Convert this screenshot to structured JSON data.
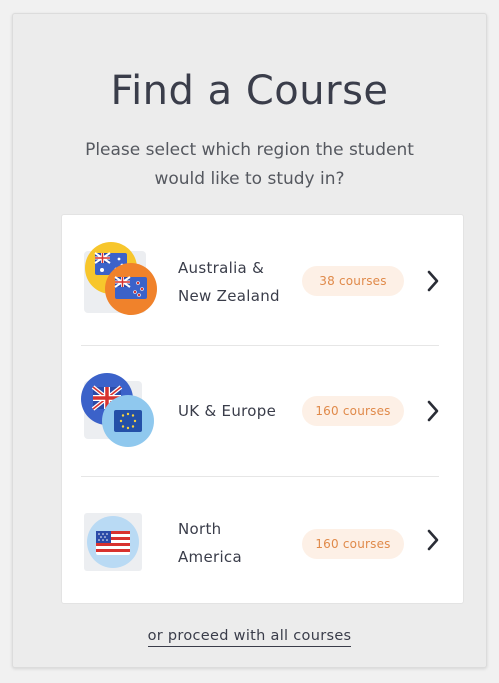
{
  "title": "Find a Course",
  "subtitle": "Please select which region the student would like to study in?",
  "regions": [
    {
      "label": "Australia & New Zealand",
      "badge": "38 courses",
      "icon": "australia-new-zealand-flags-icon"
    },
    {
      "label": "UK & Europe",
      "badge": "160 courses",
      "icon": "uk-europe-flags-icon"
    },
    {
      "label": "North America",
      "badge": "160 courses",
      "icon": "usa-flag-icon"
    }
  ],
  "proceed_link": "or proceed with all courses",
  "colors": {
    "accent": "#e08a4a",
    "badge_bg": "#fdf0e6",
    "text": "#3a3d4a",
    "panel_bg": "#ececec",
    "card_bg": "#ffffff"
  }
}
